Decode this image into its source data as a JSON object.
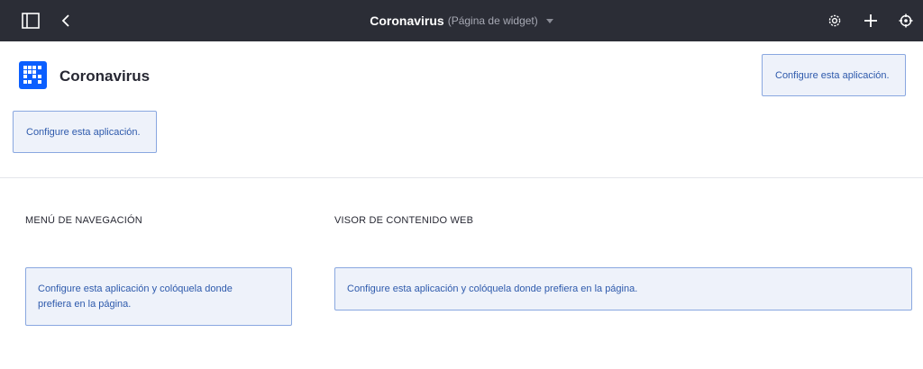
{
  "topbar": {
    "title": "Coronavirus",
    "subtitle": "(Página de widget)",
    "icons": [
      "sidebar-toggle-icon",
      "back-chevron-icon",
      "gear-icon",
      "plus-icon",
      "simulation-icon"
    ]
  },
  "site": {
    "title": "Coronavirus",
    "configure_right": "Configure esta aplicación.",
    "configure_left": "Configure esta aplicación."
  },
  "columns": {
    "nav": {
      "heading": "MENÚ DE NAVEGACIÓN",
      "message": "Configure esta aplicación y colóquela donde prefiera en la página."
    },
    "web": {
      "heading": "VISOR DE CONTENIDO WEB",
      "message": "Configure esta aplicación y colóquela donde prefiera en la página."
    }
  },
  "colors": {
    "topbar": "#2b2d36",
    "accent": "#0b5fff",
    "alert_bg": "#eef2fa",
    "alert_border": "#89a7e0",
    "alert_text": "#2e5aac"
  }
}
